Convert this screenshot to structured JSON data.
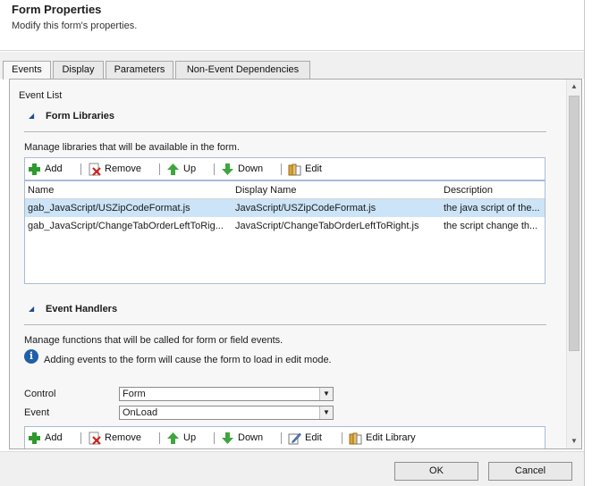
{
  "header": {
    "title": "Form Properties",
    "subtitle": "Modify this form's properties."
  },
  "tabs": [
    {
      "label": "Events",
      "active": true
    },
    {
      "label": "Display"
    },
    {
      "label": "Parameters"
    },
    {
      "label": "Non-Event Dependencies"
    }
  ],
  "event_list_label": "Event List",
  "form_libraries": {
    "title": "Form Libraries",
    "description": "Manage libraries that will be available in the form.",
    "toolbar": {
      "add": "Add",
      "remove": "Remove",
      "up": "Up",
      "down": "Down",
      "edit": "Edit"
    },
    "columns": [
      "Name",
      "Display Name",
      "Description"
    ],
    "rows": [
      {
        "name": "gab_JavaScript/USZipCodeFormat.js",
        "display_name": "JavaScript/USZipCodeFormat.js",
        "description": "the java script of the...",
        "selected": true
      },
      {
        "name": "gab_JavaScript/ChangeTabOrderLeftToRig...",
        "display_name": "JavaScript/ChangeTabOrderLeftToRight.js",
        "description": "the script change th..."
      }
    ]
  },
  "event_handlers": {
    "title": "Event Handlers",
    "description": "Manage functions that will be called for form or field events.",
    "info": "Adding events to the form will cause the form to load in edit mode.",
    "control_label": "Control",
    "control_value": "Form",
    "event_label": "Event",
    "event_value": "OnLoad",
    "toolbar": {
      "add": "Add",
      "remove": "Remove",
      "up": "Up",
      "down": "Down",
      "edit": "Edit",
      "edit_library": "Edit Library"
    }
  },
  "footer": {
    "ok": "OK",
    "cancel": "Cancel"
  },
  "colors": {
    "selected_row": "#cce4f7",
    "toolbar_border": "#a7bcd6",
    "info_icon": "#1f5fa8"
  }
}
